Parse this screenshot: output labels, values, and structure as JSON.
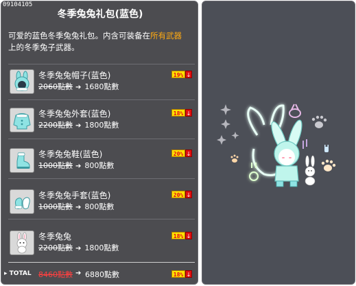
{
  "item_id": "09104105",
  "title": "冬季兔兔礼包(蓝色)",
  "description": {
    "part1": "可爱的蓝色冬季兔兔礼包。内含可装备在",
    "highlight": "所有武器",
    "part2": "上的冬季兔子武器。"
  },
  "items": [
    {
      "name": "冬季兔兔帽子(蓝色)",
      "original_price": "2060點數",
      "price": "1680點數",
      "discount": "19%",
      "icon": "bunny-hat-icon"
    },
    {
      "name": "冬季兔兔外套(蓝色)",
      "original_price": "2200點數",
      "price": "1800點數",
      "discount": "18%",
      "icon": "coat-icon"
    },
    {
      "name": "冬季兔兔鞋(蓝色)",
      "original_price": "1000點數",
      "price": "800點數",
      "discount": "20%",
      "icon": "shoes-icon"
    },
    {
      "name": "冬季兔兔手套(蓝色)",
      "original_price": "1000點數",
      "price": "800點數",
      "discount": "20%",
      "icon": "gloves-icon"
    },
    {
      "name": "冬季兔兔",
      "original_price": "2200點數",
      "price": "1800點數",
      "discount": "18%",
      "icon": "bunny-weapon-icon"
    }
  ],
  "total": {
    "label": "TOTAL",
    "original_price": "8460點數",
    "price": "6880點數",
    "discount": "18%"
  },
  "colors": {
    "highlight": "#ffaa11",
    "panel_bg": "#4c4c50",
    "badge_yellow": "#ffe400",
    "badge_red": "#e01010"
  }
}
